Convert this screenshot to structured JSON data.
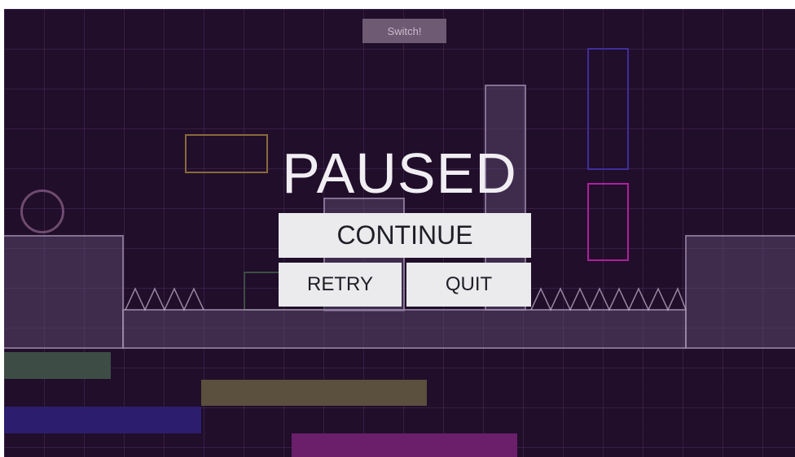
{
  "hud": {
    "switch_label": "Switch!"
  },
  "pause_menu": {
    "title": "PAUSED",
    "continue_label": "CONTINUE",
    "retry_label": "RETRY",
    "quit_label": "QUIT"
  },
  "colors": {
    "background": "#200e2a",
    "bar_green": "#3d4d45",
    "bar_olive": "#5b4f3d",
    "bar_blue": "#2c1d6e",
    "bar_magenta": "#6b1f6a",
    "outline_gold": "#8a6a3a",
    "outline_blue": "#3f2e9a",
    "outline_magenta": "#b01f9e"
  }
}
